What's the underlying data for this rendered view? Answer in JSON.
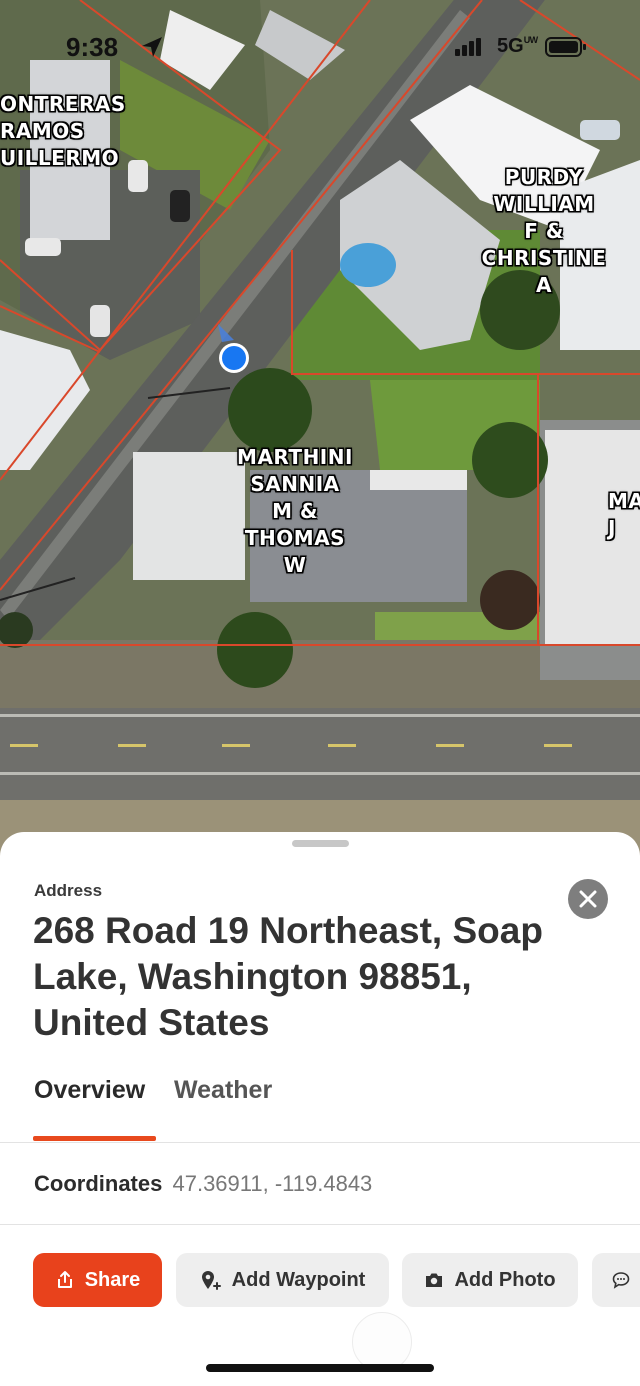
{
  "status_bar": {
    "time": "9:38",
    "network": "5G",
    "network_suffix": "UW",
    "location_icon": "location-arrow-icon",
    "signal_icon": "signal-bars-icon",
    "battery_icon": "battery-icon"
  },
  "map": {
    "parcels": [
      {
        "lines": [
          "ONTRERAS",
          "RAMOS",
          "UILLERMO"
        ]
      },
      {
        "lines": [
          "PURDY",
          "WILLIAM",
          "F &",
          "CHRISTINE",
          "A"
        ]
      },
      {
        "lines": [
          "MARTHINI",
          "SANNIA",
          "M &",
          "THOMAS",
          "W"
        ]
      },
      {
        "lines": [
          "MA",
          "J"
        ]
      }
    ],
    "parcel_line_color": "#d9482b",
    "user_location_color": "#1877f2"
  },
  "sheet": {
    "address_label": "Address",
    "address": "268 Road 19 Northeast, Soap Lake, Washington 98851, United States",
    "close_icon": "close-icon",
    "tabs": [
      {
        "label": "Overview",
        "active": true
      },
      {
        "label": "Weather",
        "active": false
      }
    ],
    "coordinates_label": "Coordinates",
    "coordinates_value": "47.36911, -119.4843",
    "actions": [
      {
        "label": "Share",
        "icon": "share-icon"
      },
      {
        "label": "Add Waypoint",
        "icon": "add-waypoint-icon"
      },
      {
        "label": "Add Photo",
        "icon": "camera-icon"
      },
      {
        "label": "",
        "icon": "message-icon"
      }
    ],
    "accent_color": "#e8421c"
  }
}
